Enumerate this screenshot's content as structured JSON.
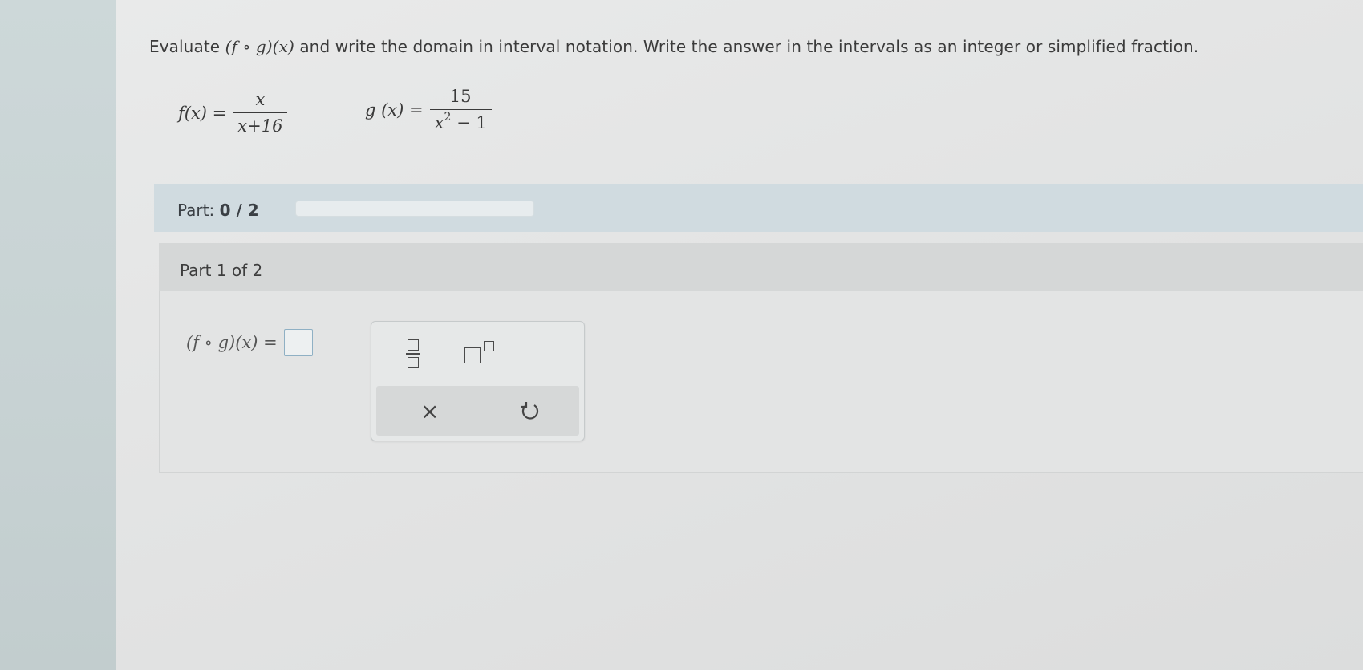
{
  "instructions": {
    "prefix": "Evaluate",
    "expression": "(f ∘ g)(x)",
    "suffix": "and write the domain in interval notation. Write the answer in the intervals as an integer or simplified fraction."
  },
  "functions": {
    "f": {
      "lhs": "f(x) =",
      "numerator": "x",
      "denominator": "x+16"
    },
    "g": {
      "lhs": "g (x) =",
      "numerator": "15",
      "denominator_base": "x",
      "denominator_exp": "2",
      "denominator_rest": " − 1"
    }
  },
  "progress": {
    "label": "Part:",
    "value": "0 / 2",
    "fraction": 0
  },
  "section": {
    "title": "Part 1 of 2",
    "answer_label": "(f ∘ g)(x) ="
  },
  "toolbar": {
    "fraction_icon": "fraction-icon",
    "exponent_icon": "exponent-icon",
    "clear_label": "×",
    "undo_icon": "undo-icon"
  }
}
